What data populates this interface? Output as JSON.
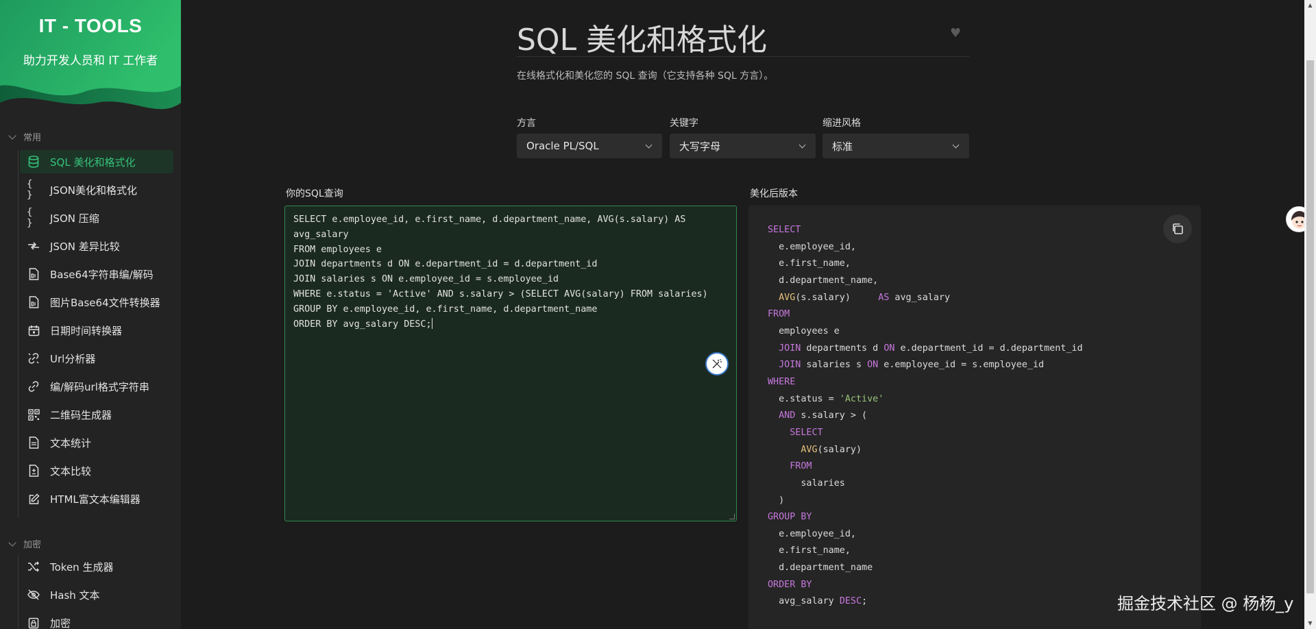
{
  "brand": {
    "title": "IT - TOOLS",
    "subtitle": "助力开发人员和 IT 工作者"
  },
  "sidebar": {
    "sections": [
      {
        "title": "常用",
        "items": [
          {
            "label": "SQL 美化和格式化",
            "icon": "database-icon",
            "active": true
          },
          {
            "label": "JSON美化和格式化",
            "icon": "braces-icon"
          },
          {
            "label": "JSON 压缩",
            "icon": "braces-icon"
          },
          {
            "label": "JSON 差异比较",
            "icon": "compare-arrows-icon"
          },
          {
            "label": "Base64字符串编/解码",
            "icon": "file-binary-icon"
          },
          {
            "label": "图片Base64文件转换器",
            "icon": "file-binary-icon"
          },
          {
            "label": "日期时间转换器",
            "icon": "calendar-icon"
          },
          {
            "label": "Url分析器",
            "icon": "unlink-icon"
          },
          {
            "label": "编/解码url格式字符串",
            "icon": "link-icon"
          },
          {
            "label": "二维码生成器",
            "icon": "qrcode-icon"
          },
          {
            "label": "文本统计",
            "icon": "file-text-icon"
          },
          {
            "label": "文本比较",
            "icon": "file-diff-icon"
          },
          {
            "label": "HTML富文本编辑器",
            "icon": "edit-icon"
          }
        ]
      },
      {
        "title": "加密",
        "items": [
          {
            "label": "Token 生成器",
            "icon": "shuffle-icon"
          },
          {
            "label": "Hash 文本",
            "icon": "eye-off-icon"
          },
          {
            "label": "加密",
            "icon": "lock-icon"
          }
        ]
      }
    ]
  },
  "page": {
    "title": "SQL 美化和格式化",
    "description": "在线格式化和美化您的 SQL 查询（它支持各种 SQL 方言）。"
  },
  "options": {
    "dialect": {
      "label": "方言",
      "value": "Oracle PL/SQL"
    },
    "keyword": {
      "label": "关键字",
      "value": "大写字母"
    },
    "indent": {
      "label": "缩进风格",
      "value": "标准"
    }
  },
  "input": {
    "label": "你的SQL查询",
    "value": "SELECT e.employee_id, e.first_name, d.department_name, AVG(s.salary) AS\navg_salary\nFROM employees e\nJOIN departments d ON e.department_id = d.department_id\nJOIN salaries s ON e.employee_id = s.employee_id\nWHERE e.status = 'Active' AND s.salary > (SELECT AVG(salary) FROM salaries)\nGROUP BY e.employee_id, e.first_name, d.department_name\nORDER BY avg_salary DESC;"
  },
  "output": {
    "label": "美化后版本",
    "lines": [
      [
        {
          "t": "SELECT",
          "c": "kw"
        }
      ],
      [
        {
          "t": "  e.employee_id,"
        }
      ],
      [
        {
          "t": "  e.first_name,"
        }
      ],
      [
        {
          "t": "  d.department_name,"
        }
      ],
      [
        {
          "t": "  "
        },
        {
          "t": "AVG",
          "c": "fn"
        },
        {
          "t": "(s.salary)     "
        },
        {
          "t": "AS",
          "c": "kw"
        },
        {
          "t": " avg_salary"
        }
      ],
      [
        {
          "t": "FROM",
          "c": "kw"
        }
      ],
      [
        {
          "t": "  employees e"
        }
      ],
      [
        {
          "t": "  "
        },
        {
          "t": "JOIN",
          "c": "kw"
        },
        {
          "t": " departments d "
        },
        {
          "t": "ON",
          "c": "kw"
        },
        {
          "t": " e.department_id = d.department_id"
        }
      ],
      [
        {
          "t": "  "
        },
        {
          "t": "JOIN",
          "c": "kw"
        },
        {
          "t": " salaries s "
        },
        {
          "t": "ON",
          "c": "kw"
        },
        {
          "t": " e.employee_id = s.employee_id"
        }
      ],
      [
        {
          "t": "WHERE",
          "c": "kw"
        }
      ],
      [
        {
          "t": "  e.status = "
        },
        {
          "t": "'Active'",
          "c": "str"
        }
      ],
      [
        {
          "t": "  "
        },
        {
          "t": "AND",
          "c": "kw"
        },
        {
          "t": " s.salary > ("
        }
      ],
      [
        {
          "t": "    "
        },
        {
          "t": "SELECT",
          "c": "kw"
        }
      ],
      [
        {
          "t": "      "
        },
        {
          "t": "AVG",
          "c": "fn"
        },
        {
          "t": "(salary)"
        }
      ],
      [
        {
          "t": "    "
        },
        {
          "t": "FROM",
          "c": "kw"
        }
      ],
      [
        {
          "t": "      salaries"
        }
      ],
      [
        {
          "t": "  )"
        }
      ],
      [
        {
          "t": "GROUP BY",
          "c": "kw"
        }
      ],
      [
        {
          "t": "  e.employee_id,"
        }
      ],
      [
        {
          "t": "  e.first_name,"
        }
      ],
      [
        {
          "t": "  d.department_name"
        }
      ],
      [
        {
          "t": "ORDER BY",
          "c": "kw"
        }
      ],
      [
        {
          "t": "  avg_salary "
        },
        {
          "t": "DESC",
          "c": "kw"
        },
        {
          "t": ";"
        }
      ]
    ]
  },
  "watermark": "掘金技术社区 @ 杨杨_y",
  "colors": {
    "accent": "#36c17a",
    "keyword": "#c678dd",
    "function": "#e5c07b",
    "string": "#98c379"
  }
}
